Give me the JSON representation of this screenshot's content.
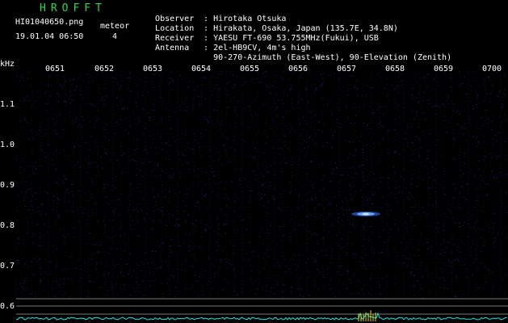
{
  "header": {
    "brand": "HROFFT",
    "filename": "HI01040650.png",
    "timestamp": "19.01.04 06:50",
    "meteor_label": "meteor",
    "meteor_count": "4"
  },
  "info": [
    {
      "key": "Observer",
      "value": "Hirotaka Otsuka"
    },
    {
      "key": "Location",
      "value": "Hirakata, Osaka, Japan (135.7E, 34.8N)"
    },
    {
      "key": "Receiver",
      "value": "YAESU FT-690 53.755MHz(Fukui), USB"
    },
    {
      "key": "Antenna",
      "value": "2el-HB9CV, 4m's high"
    },
    {
      "key": "",
      "value": "90-270-Azimuth (East-West), 90-Elevation (Zenith)"
    }
  ],
  "axis": {
    "unit": "kHz",
    "times": [
      "0651",
      "0652",
      "0653",
      "0654",
      "0655",
      "0656",
      "0657",
      "0658",
      "0659",
      "0700"
    ],
    "freqs": [
      "1.1",
      "1.0",
      "0.9",
      "0.8",
      "0.7",
      "0.6"
    ]
  },
  "colors": {
    "background": "#000000",
    "noise": "#1a1a8c",
    "brand": "#2fd84a",
    "echo": "#6fa8ff",
    "baseline": "#20e0e0",
    "spike": "#e0e020"
  }
}
